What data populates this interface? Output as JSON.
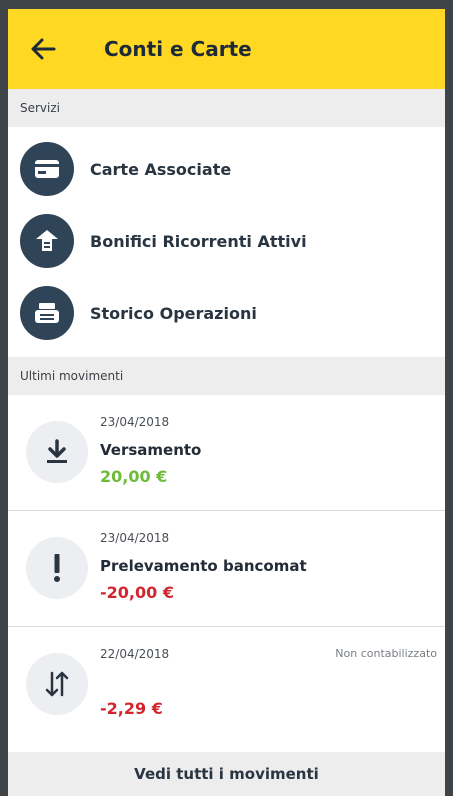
{
  "header": {
    "title": "Conti e Carte",
    "back_icon": "arrow-left-icon",
    "background_color": "#ffd824"
  },
  "services": {
    "section_label": "Servizi",
    "items": [
      {
        "label": "Carte Associate",
        "icon": "card-icon"
      },
      {
        "label": "Bonifici Ricorrenti Attivi",
        "icon": "transfer-icon"
      },
      {
        "label": "Storico Operazioni",
        "icon": "history-icon"
      }
    ],
    "icon_color": "#2f4457"
  },
  "movements": {
    "section_label": "Ultimi movimenti",
    "items": [
      {
        "date": "23/04/2018",
        "title": "Versamento",
        "amount": "20,00 €",
        "icon": "download-icon",
        "status": ""
      },
      {
        "date": "23/04/2018",
        "title": "Prelevamento bancomat",
        "amount": "-20,00 €",
        "icon": "exclamation-icon",
        "status": ""
      },
      {
        "date": "22/04/2018",
        "title": "",
        "amount": "-2,29 €",
        "icon": "swap-vertical-icon",
        "status": "Non contabilizzato"
      }
    ],
    "positive_color": "#6dbb3a",
    "negative_color": "#d2262f"
  },
  "footer": {
    "link_label": "Vedi tutti i movimenti"
  }
}
